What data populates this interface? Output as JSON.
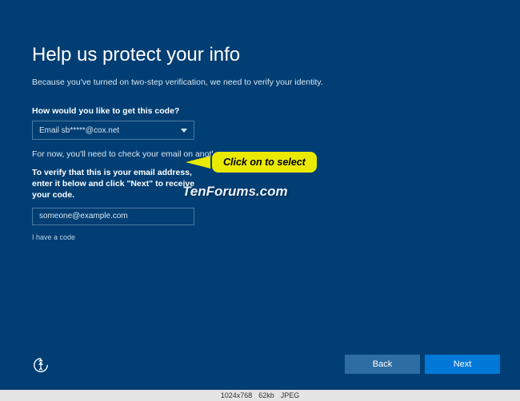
{
  "title": "Help us protect your info",
  "subtitle": "Because you've turned on two-step verification, we need to verify your identity.",
  "question": "How would you like to get this code?",
  "dropdown_value": "Email sb*****@cox.net",
  "note": "For now, you'll need to check your email on another device.",
  "verify_instruction": "To verify that this is your email address, enter it below and click \"Next\" to receive your code.",
  "email_placeholder": "someone@example.com",
  "have_code": "I have a code",
  "buttons": {
    "back": "Back",
    "next": "Next"
  },
  "callout": "Click on to select",
  "watermark": "TenForums.com",
  "footer": {
    "dims": "1024x768",
    "size": "62kb",
    "fmt": "JPEG"
  }
}
